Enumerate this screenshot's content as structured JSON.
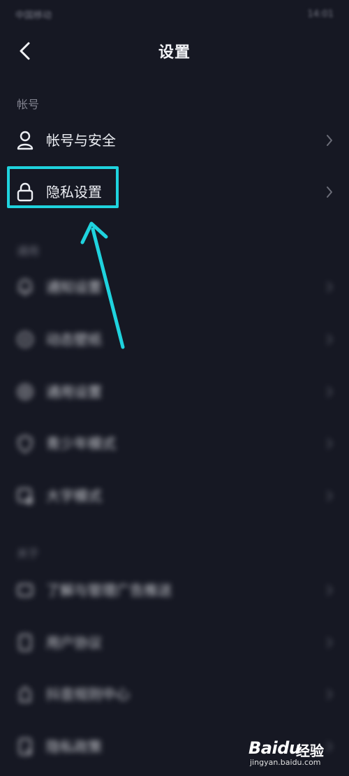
{
  "status_bar": {
    "left": "中国移动",
    "right": "14:01"
  },
  "header": {
    "title": "设置"
  },
  "sections": [
    {
      "label": "帐号",
      "items": [
        {
          "label": "帐号与安全",
          "icon": "user-icon"
        },
        {
          "label": "隐私设置",
          "icon": "lock-icon",
          "highlighted": true
        }
      ]
    },
    {
      "label": "通用",
      "items": [
        {
          "label": "通知设置",
          "icon": "bell-icon"
        },
        {
          "label": "动态壁纸",
          "icon": "wallpaper-icon"
        },
        {
          "label": "通用设置",
          "icon": "gear-icon"
        },
        {
          "label": "青少年模式",
          "icon": "shield-icon"
        },
        {
          "label": "大字模式",
          "icon": "text-size-icon"
        }
      ]
    },
    {
      "label": "关于",
      "items": [
        {
          "label": "了解与管理广告推送",
          "icon": "ad-icon"
        },
        {
          "label": "用户协议",
          "icon": "document-icon"
        },
        {
          "label": "抖音规则中心",
          "icon": "rules-icon"
        },
        {
          "label": "隐私政策",
          "icon": "policy-icon"
        }
      ]
    }
  ],
  "watermark": {
    "brand_left": "Bai",
    "brand_right": "du",
    "brand_cn": "经验",
    "url": "jingyan.baidu.com"
  },
  "colors": {
    "background": "#161823",
    "highlight": "#1fd3de",
    "text": "#eceef3",
    "muted": "#80828e"
  }
}
